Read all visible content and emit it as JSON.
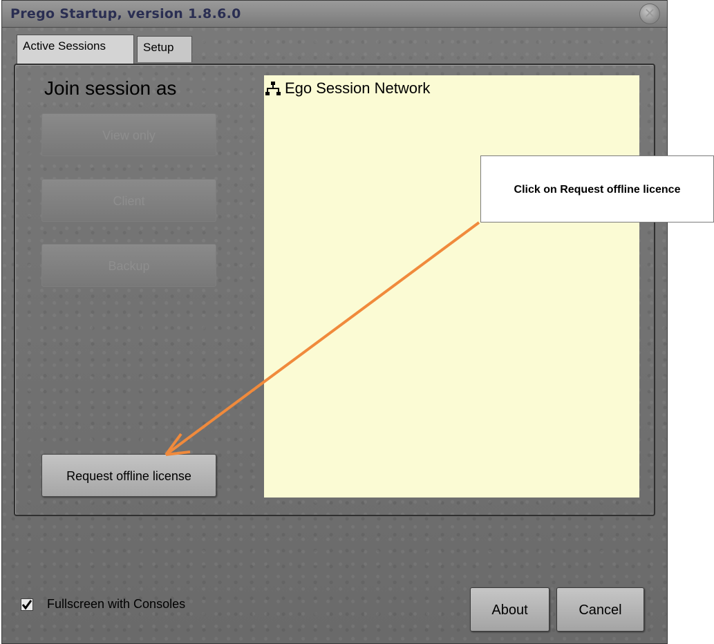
{
  "window": {
    "title": "Prego Startup, version 1.8.6.0",
    "close_icon": "close-icon"
  },
  "tabs": [
    {
      "label": "Active Sessions",
      "active": true
    },
    {
      "label": "Setup",
      "active": false
    }
  ],
  "join": {
    "heading": "Join session as",
    "buttons": [
      {
        "label": "View only",
        "enabled": false
      },
      {
        "label": "Client",
        "enabled": false
      },
      {
        "label": "Backup",
        "enabled": false
      }
    ],
    "request_button": "Request offline license"
  },
  "sessions": {
    "root_icon": "network-tree-icon",
    "root_label": "Ego Session Network",
    "background": "#fbfbd4"
  },
  "footer": {
    "fullscreen_label": "Fullscreen with Consoles",
    "fullscreen_checked": true,
    "about_label": "About",
    "cancel_label": "Cancel"
  },
  "annotation": {
    "text": "Click on Request offline licence",
    "arrow_color": "#f08a3c"
  }
}
